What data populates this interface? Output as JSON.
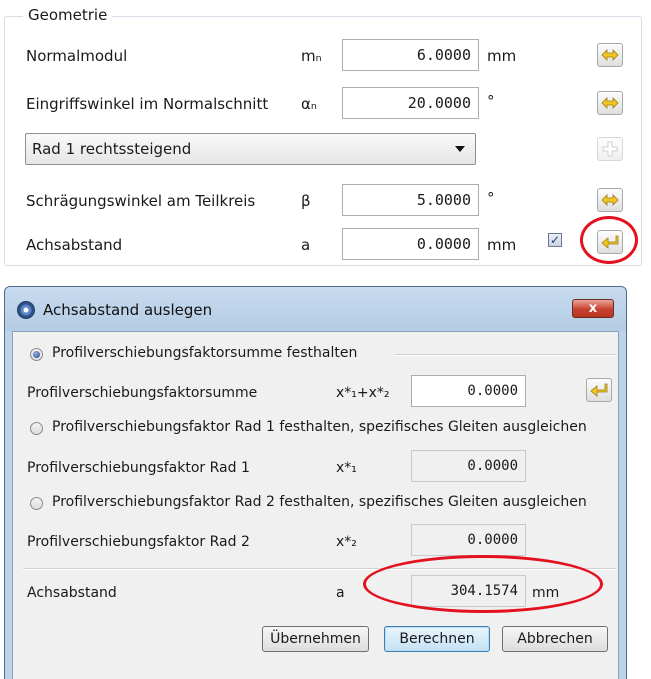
{
  "geometry": {
    "title": "Geometrie",
    "rows": [
      {
        "label": "Normalmodul",
        "symbol": "mₙ",
        "value": "6.0000",
        "unit": "mm"
      },
      {
        "label": "Eingriffswinkel im Normalschnitt",
        "symbol": "αₙ",
        "value": "20.0000",
        "unit": "°"
      },
      {
        "label": "Schrägungswinkel am Teilkreis",
        "symbol": "β",
        "value": "5.0000",
        "unit": "°"
      },
      {
        "label": "Achsabstand",
        "symbol": "a",
        "value": "0.0000",
        "unit": "mm"
      }
    ],
    "helix_select": "Rad 1 rechtssteigend",
    "achsabstand_checked": true
  },
  "dialog": {
    "title": "Achsabstand auslegen",
    "close_label": "x",
    "option1": "Profilverschiebungsfaktorsumme festhalten",
    "row1": {
      "label": "Profilverschiebungsfaktorsumme",
      "symbol": "x*₁+x*₂",
      "value": "0.0000"
    },
    "option2": "Profilverschiebungsfaktor Rad 1 festhalten, spezifisches Gleiten ausgleichen",
    "row2": {
      "label": "Profilverschiebungsfaktor Rad 1",
      "symbol": "x*₁",
      "value": "0.0000"
    },
    "option3": "Profilverschiebungsfaktor Rad 2 festhalten, spezifisches Gleiten ausgleichen",
    "row3": {
      "label": "Profilverschiebungsfaktor Rad 2",
      "symbol": "x*₂",
      "value": "0.0000"
    },
    "result": {
      "label": "Achsabstand",
      "symbol": "a",
      "value": "304.1574",
      "unit": "mm"
    },
    "buttons": {
      "apply": "Übernehmen",
      "calculate": "Berechnen",
      "cancel": "Abbrechen"
    },
    "selected_option": 1
  },
  "colors": {
    "highlight_ring": "#e5101e",
    "icon_yellow": "#f2c623"
  },
  "icons": {
    "lock_toggle": "double-arrow-icon",
    "transfer": "return-arrow-icon",
    "add": "plus-icon"
  }
}
